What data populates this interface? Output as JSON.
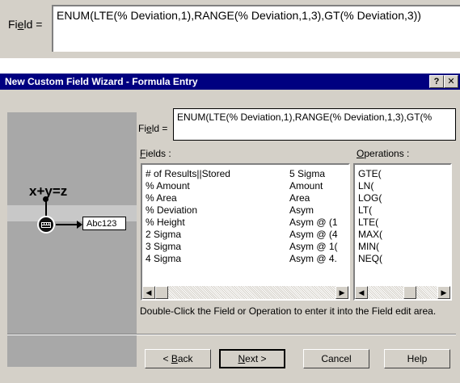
{
  "top": {
    "field_label_prefix": "Fi",
    "field_label_accel": "e",
    "field_label_suffix": "ld =",
    "field_value": "ENUM(LTE(% Deviation,1),RANGE(% Deviation,1,3),GT(% Deviation,3))"
  },
  "dialog": {
    "title": "New Custom Field Wizard - Formula Entry",
    "help_button": "?",
    "close_button": "✕",
    "image": {
      "formula_text": "x+y=z",
      "node_label": "Abc123"
    },
    "field": {
      "label_prefix": "Fi",
      "label_accel": "e",
      "label_suffix": "ld =",
      "value": "ENUM(LTE(% Deviation,1),RANGE(% Deviation,1,3),GT(%"
    },
    "fields_list": {
      "label_accel": "F",
      "label_rest": "ields :",
      "col1": [
        "# of Results||Stored",
        "% Amount",
        "% Area",
        "% Deviation",
        "% Height",
        "2 Sigma",
        "3 Sigma",
        "4 Sigma"
      ],
      "col2": [
        "5 Sigma",
        "Amount",
        "Area",
        "Asym",
        "Asym @ (1",
        "Asym @ (4",
        "Asym @ 1(",
        "Asym @ 4."
      ]
    },
    "operations_list": {
      "label_accel": "O",
      "label_rest": "perations :",
      "items": [
        "GTE(",
        "LN(",
        "LOG(",
        "LT(",
        "LTE(",
        "MAX(",
        "MIN(",
        "NEQ("
      ]
    },
    "hint": "Double-Click the Field or Operation to enter it into the Field edit area.",
    "buttons": {
      "back_prefix": "< ",
      "back_accel": "B",
      "back_rest": "ack",
      "next_accel": "N",
      "next_rest": "ext >",
      "cancel": "Cancel",
      "help": "Help"
    }
  },
  "colors": {
    "titlebar": "#000080",
    "face": "#d4d0c8",
    "image_bg": "#a8a8a8"
  }
}
